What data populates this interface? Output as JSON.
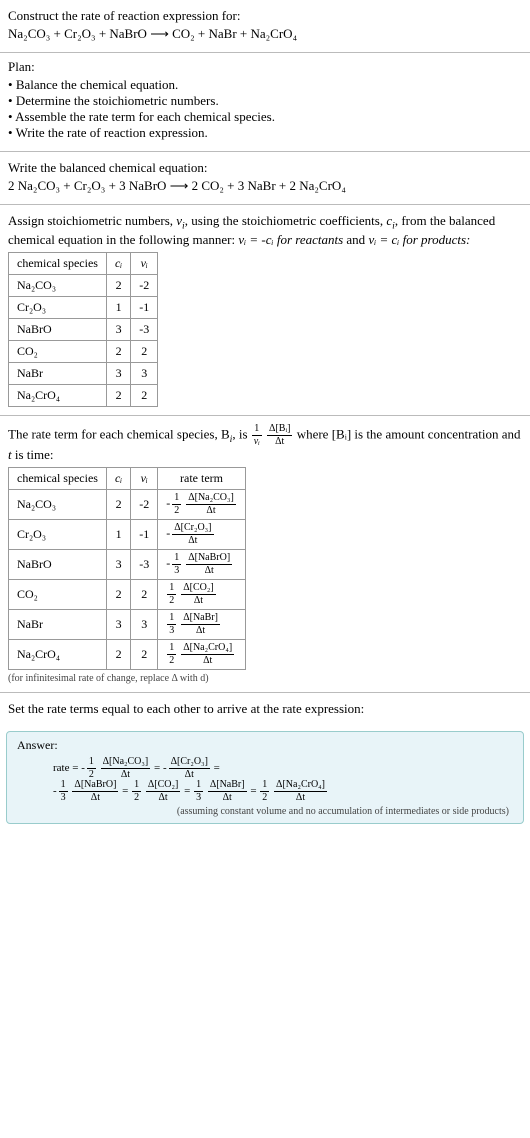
{
  "header": {
    "prompt": "Construct the rate of reaction expression for:",
    "equation": "Na₂CO₃ + Cr₂O₃ + NaBrO  ⟶  CO₂ + NaBr + Na₂CrO₄"
  },
  "plan": {
    "title": "Plan:",
    "items": [
      "Balance the chemical equation.",
      "Determine the stoichiometric numbers.",
      "Assemble the rate term for each chemical species.",
      "Write the rate of reaction expression."
    ]
  },
  "balance": {
    "prompt": "Write the balanced chemical equation:",
    "equation": "2 Na₂CO₃ + Cr₂O₃ + 3 NaBrO  ⟶  2 CO₂ + 3 NaBr + 2 Na₂CrO₄"
  },
  "stoich": {
    "intro_a": "Assign stoichiometric numbers, ",
    "nu_i": "ν",
    "intro_b": ", using the stoichiometric coefficients, ",
    "c_i": "c",
    "intro_c": ", from the balanced chemical equation in the following manner: ",
    "rel_react": "νᵢ = -cᵢ for reactants",
    "rel_and": " and ",
    "rel_prod": "νᵢ = cᵢ for products:",
    "headers": {
      "species": "chemical species",
      "ci": "cᵢ",
      "vi": "νᵢ"
    },
    "rows": [
      {
        "sp": "Na₂CO₃",
        "c": "2",
        "v": "-2"
      },
      {
        "sp": "Cr₂O₃",
        "c": "1",
        "v": "-1"
      },
      {
        "sp": "NaBrO",
        "c": "3",
        "v": "-3"
      },
      {
        "sp": "CO₂",
        "c": "2",
        "v": "2"
      },
      {
        "sp": "NaBr",
        "c": "3",
        "v": "3"
      },
      {
        "sp": "Na₂CrO₄",
        "c": "2",
        "v": "2"
      }
    ]
  },
  "rateterm": {
    "intro_a": "The rate term for each chemical species, B",
    "intro_b": ", is ",
    "frac1_num": "1",
    "frac1_den": "νᵢ",
    "frac2_num": "Δ[Bᵢ]",
    "frac2_den": "Δt",
    "intro_c": " where [Bᵢ] is the amount concentration and ",
    "t": "t",
    "intro_d": " is time:",
    "headers": {
      "species": "chemical species",
      "ci": "cᵢ",
      "vi": "νᵢ",
      "rate": "rate term"
    },
    "rows": [
      {
        "sp": "Na₂CO₃",
        "c": "2",
        "v": "-2",
        "sign": "-",
        "coef_num": "1",
        "coef_den": "2",
        "dnum": "Δ[Na₂CO₃]",
        "dden": "Δt"
      },
      {
        "sp": "Cr₂O₃",
        "c": "1",
        "v": "-1",
        "sign": "-",
        "coef_num": "",
        "coef_den": "",
        "dnum": "Δ[Cr₂O₃]",
        "dden": "Δt"
      },
      {
        "sp": "NaBrO",
        "c": "3",
        "v": "-3",
        "sign": "-",
        "coef_num": "1",
        "coef_den": "3",
        "dnum": "Δ[NaBrO]",
        "dden": "Δt"
      },
      {
        "sp": "CO₂",
        "c": "2",
        "v": "2",
        "sign": "",
        "coef_num": "1",
        "coef_den": "2",
        "dnum": "Δ[CO₂]",
        "dden": "Δt"
      },
      {
        "sp": "NaBr",
        "c": "3",
        "v": "3",
        "sign": "",
        "coef_num": "1",
        "coef_den": "3",
        "dnum": "Δ[NaBr]",
        "dden": "Δt"
      },
      {
        "sp": "Na₂CrO₄",
        "c": "2",
        "v": "2",
        "sign": "",
        "coef_num": "1",
        "coef_den": "2",
        "dnum": "Δ[Na₂CrO₄]",
        "dden": "Δt"
      }
    ],
    "footnote": "(for infinitesimal rate of change, replace Δ with d)"
  },
  "final": {
    "prompt": "Set the rate terms equal to each other to arrive at the rate expression:"
  },
  "answer": {
    "label": "Answer:",
    "prefix": "rate = ",
    "terms": [
      {
        "sign": "-",
        "coef_num": "1",
        "coef_den": "2",
        "dnum": "Δ[Na₂CO₃]",
        "dden": "Δt"
      },
      {
        "sign": "-",
        "coef_num": "",
        "coef_den": "",
        "dnum": "Δ[Cr₂O₃]",
        "dden": "Δt"
      },
      {
        "sign": "-",
        "coef_num": "1",
        "coef_den": "3",
        "dnum": "Δ[NaBrO]",
        "dden": "Δt"
      },
      {
        "sign": "",
        "coef_num": "1",
        "coef_den": "2",
        "dnum": "Δ[CO₂]",
        "dden": "Δt"
      },
      {
        "sign": "",
        "coef_num": "1",
        "coef_den": "3",
        "dnum": "Δ[NaBr]",
        "dden": "Δt"
      },
      {
        "sign": "",
        "coef_num": "1",
        "coef_den": "2",
        "dnum": "Δ[Na₂CrO₄]",
        "dden": "Δt"
      }
    ],
    "eq": " = ",
    "footnote": "(assuming constant volume and no accumulation of intermediates or side products)"
  }
}
